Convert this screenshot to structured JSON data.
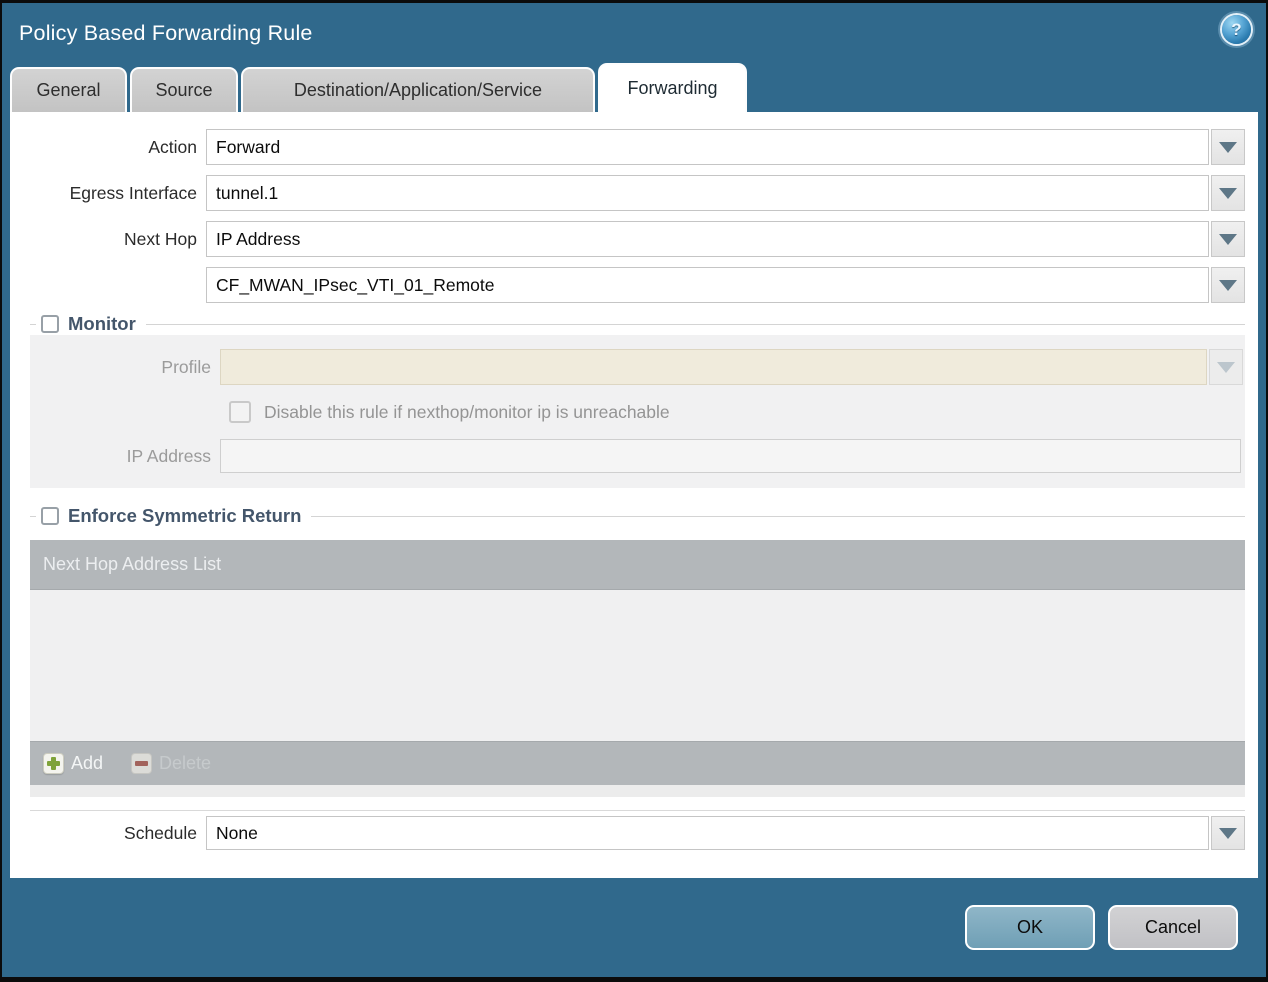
{
  "dialog": {
    "title": "Policy Based Forwarding Rule",
    "help_icon": "?"
  },
  "tabs": [
    {
      "label": "General",
      "active": false
    },
    {
      "label": "Source",
      "active": false
    },
    {
      "label": "Destination/Application/Service",
      "active": false
    },
    {
      "label": "Forwarding",
      "active": true
    }
  ],
  "form": {
    "action": {
      "label": "Action",
      "value": "Forward"
    },
    "egress_interface": {
      "label": "Egress Interface",
      "value": "tunnel.1"
    },
    "next_hop": {
      "label": "Next Hop",
      "value": "IP Address"
    },
    "next_hop_address": {
      "value": "CF_MWAN_IPsec_VTI_01_Remote"
    },
    "schedule": {
      "label": "Schedule",
      "value": "None"
    }
  },
  "monitor": {
    "legend": "Monitor",
    "checked": false,
    "profile": {
      "label": "Profile",
      "value": ""
    },
    "disable_rule_label": "Disable this rule if nexthop/monitor ip is unreachable",
    "disable_rule_checked": false,
    "ip_address": {
      "label": "IP Address",
      "value": ""
    }
  },
  "symmetric_return": {
    "legend": "Enforce Symmetric Return",
    "checked": false,
    "table": {
      "header": "Next Hop Address List",
      "rows": [],
      "add_label": "Add",
      "delete_label": "Delete"
    }
  },
  "footer": {
    "ok_label": "OK",
    "cancel_label": "Cancel"
  },
  "colors": {
    "frame": "#30698c",
    "tab_inactive": "#c9c9c9",
    "panel_disabled": "#f1f1f2",
    "profile_field": "#f0ebdc",
    "table_chrome": "#b3b7ba",
    "legend_text": "#44566b",
    "ok_button": "#7da9be",
    "cancel_button": "#c9c9cc",
    "add_plus": "#7fa33a",
    "delete_minus": "#a2635c"
  }
}
